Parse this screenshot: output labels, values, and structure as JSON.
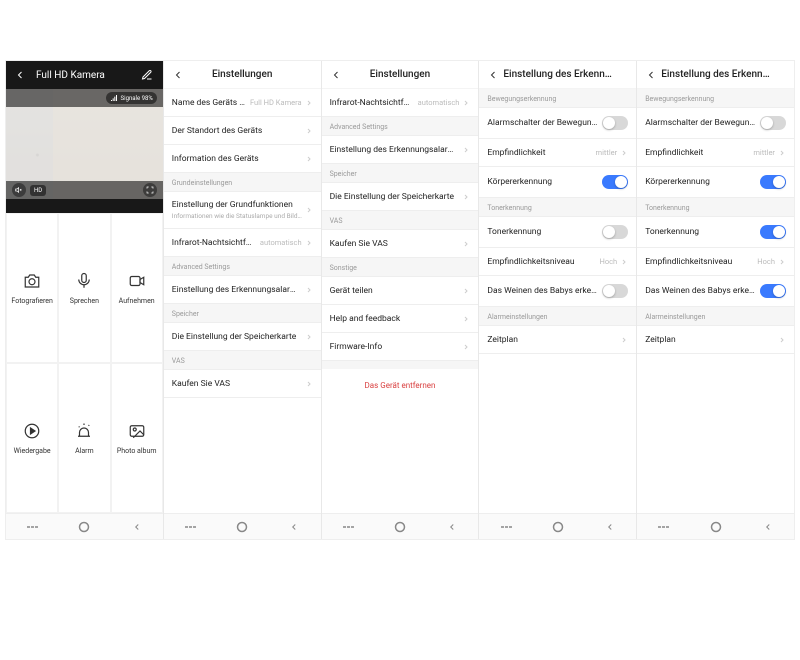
{
  "screen1": {
    "title": "Full HD Kamera",
    "signal": "Signale 98%",
    "quality": "HD",
    "actions": [
      {
        "label": "Fotografieren",
        "icon": "camera"
      },
      {
        "label": "Sprechen",
        "icon": "mic"
      },
      {
        "label": "Aufnehmen",
        "icon": "record"
      },
      {
        "label": "Wiedergabe",
        "icon": "playback"
      },
      {
        "label": "Alarm",
        "icon": "alarm"
      },
      {
        "label": "Photo album",
        "icon": "album"
      }
    ]
  },
  "screen2": {
    "title": "Einstellungen",
    "rows": {
      "name": {
        "label": "Name des Geräts ändern",
        "value": "Full HD Kamera"
      },
      "location": {
        "label": "Der Standort des Geräts"
      },
      "info": {
        "label": "Information des Geräts"
      }
    },
    "sections": {
      "basic": "Grundeinstellungen",
      "advanced": "Advanced Settings",
      "storage": "Speicher",
      "vas": "VAS"
    },
    "rows2": {
      "basic": {
        "label": "Einstellung der Grundfunktionen",
        "sub": "Informationen wie die Statuslampe und Bildschirm-Flip"
      },
      "ir": {
        "label": "Infrarot-Nachtsichtfunktion",
        "value": "automatisch"
      },
      "detect": {
        "label": "Einstellung des Erkennungsalarms"
      },
      "sd": {
        "label": "Die Einstellung der Speicherkarte"
      },
      "vas": {
        "label": "Kaufen Sie VAS"
      }
    }
  },
  "screen3": {
    "title": "Einstellungen",
    "sections": {
      "advanced": "Advanced Settings",
      "storage": "Speicher",
      "vas": "VAS",
      "other": "Sonstige"
    },
    "rows": {
      "ir": {
        "label": "Infrarot-Nachtsichtfunktion",
        "value": "automatisch"
      },
      "detect": {
        "label": "Einstellung des Erkennungsalarms"
      },
      "sd": {
        "label": "Die Einstellung der Speicherkarte"
      },
      "vas": {
        "label": "Kaufen Sie VAS"
      },
      "share": {
        "label": "Gerät teilen"
      },
      "help": {
        "label": "Help and feedback"
      },
      "fw": {
        "label": "Firmware-Info"
      }
    },
    "remove": "Das Gerät entfernen"
  },
  "screen4": {
    "title": "Einstellung des Erkennungsalarms",
    "sections": {
      "motion": "Bewegungserkennung",
      "sound": "Tonerkennung",
      "alarm": "Alarmeinstellungen"
    },
    "rows": {
      "motion_switch": {
        "label": "Alarmschalter der Bewegungserkennung",
        "toggle": "off"
      },
      "sensitivity": {
        "label": "Empfindlichkeit",
        "value": "mittler"
      },
      "body": {
        "label": "Körpererkennung",
        "toggle": "on"
      },
      "sound_switch": {
        "label": "Tonerkennung",
        "toggle": "off"
      },
      "sound_level": {
        "label": "Empfindlichkeitsniveau",
        "value": "Hoch"
      },
      "baby": {
        "label": "Das Weinen des Babys erkennen",
        "toggle": "off"
      },
      "schedule": {
        "label": "Zeitplan"
      }
    }
  },
  "screen5": {
    "title": "Einstellung des Erkennungsalarms",
    "sections": {
      "motion": "Bewegungserkennung",
      "sound": "Tonerkennung",
      "alarm": "Alarmeinstellungen"
    },
    "rows": {
      "motion_switch": {
        "label": "Alarmschalter der Bewegungserkennung",
        "toggle": "off"
      },
      "sensitivity": {
        "label": "Empfindlichkeit",
        "value": "mittler"
      },
      "body": {
        "label": "Körpererkennung",
        "toggle": "on"
      },
      "sound_switch": {
        "label": "Tonerkennung",
        "toggle": "on"
      },
      "sound_level": {
        "label": "Empfindlichkeitsniveau",
        "value": "Hoch"
      },
      "baby": {
        "label": "Das Weinen des Babys erkennen",
        "toggle": "on"
      },
      "schedule": {
        "label": "Zeitplan"
      }
    }
  }
}
